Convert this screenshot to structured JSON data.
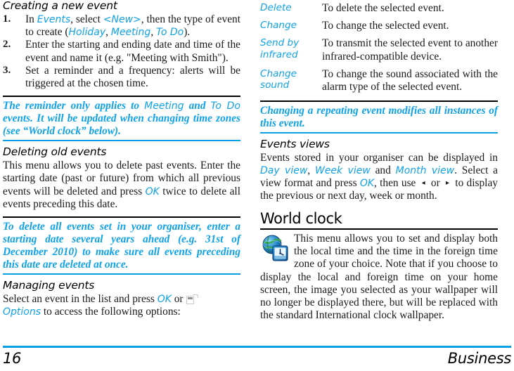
{
  "meta": {
    "accent_blue": "#10a2e8",
    "rule_blue": "#0aa0e4",
    "rule_black": "#000000"
  },
  "left_column": {
    "section_creating": {
      "heading": "Creating a new event",
      "steps": [
        {
          "num": "1.",
          "parts": [
            {
              "t": "In ",
              "s": "plain"
            },
            {
              "t": "Events",
              "s": "kw"
            },
            {
              "t": ", select ",
              "s": "plain"
            },
            {
              "t": "<New>",
              "s": "kw"
            },
            {
              "t": ", then the type of event to create (",
              "s": "plain"
            },
            {
              "t": "Holiday",
              "s": "kw"
            },
            {
              "t": ", ",
              "s": "plain"
            },
            {
              "t": "Meeting",
              "s": "kw"
            },
            {
              "t": ", ",
              "s": "plain"
            },
            {
              "t": "To Do",
              "s": "kw"
            },
            {
              "t": ").",
              "s": "plain"
            }
          ],
          "plain_text": "In Events, select <New>, then the type of event to create (Holiday, Meeting, To Do)."
        },
        {
          "num": "2.",
          "parts": [
            {
              "t": "Enter the starting and ending date and time of the event and name it (e.g. \"Meeting with Smith\").",
              "s": "plain"
            }
          ],
          "plain_text": "Enter the starting and ending date and time of the event and name it (e.g. \"Meeting with Smith\")."
        },
        {
          "num": "3.",
          "parts": [
            {
              "t": "Set a reminder and a frequency: alerts will be triggered at the chosen time.",
              "s": "plain"
            }
          ],
          "plain_text": "Set a reminder and a frequency: alerts will be triggered at the chosen time."
        }
      ]
    },
    "note_reminder": {
      "parts": [
        {
          "t": "The reminder only applies to ",
          "s": "bold"
        },
        {
          "t": "Meeting",
          "s": "plain"
        },
        {
          "t": " and ",
          "s": "bold"
        },
        {
          "t": "To Do",
          "s": "plain"
        },
        {
          "t": " events. It will be updated when changing time zones (see “World clock” below).",
          "s": "bold"
        }
      ],
      "plain_text": "The reminder only applies to Meeting and To Do events. It will be updated when changing time zones (see “World clock” below)."
    },
    "section_deleting": {
      "heading": "Deleting old events",
      "parts": [
        {
          "t": "This menu allows you to delete past events. Enter the starting date (past or future) from which all previous events will be deleted and press ",
          "s": "plain"
        },
        {
          "t": "OK",
          "s": "kw"
        },
        {
          "t": " twice to delete all events preceding this date.",
          "s": "plain"
        }
      ],
      "plain_text": "This menu allows you to delete past events. Enter the starting date (past or future) from which all previous events will be deleted and press OK twice to delete all events preceding this date."
    },
    "note_delete_all": {
      "parts": [
        {
          "t": "To delete all events set in your organiser, enter a starting date several years ahead (e.g. 31st of December 2010) to make sure all events preceding this date are deleted at once.",
          "s": "bold"
        }
      ],
      "plain_text": "To delete all events set in your organiser, enter a starting date several years ahead (e.g. 31st of December 2010) to make sure all events preceding this date are deleted at once."
    },
    "section_managing": {
      "heading": "Managing events",
      "lead_1": "Select an event in the list and press ",
      "key_ok": "OK",
      "lead_2": " or ",
      "softkey_icon": "left-softkey-icon",
      "key_options": "Options",
      "lead_3": " to access the following options:",
      "plain_text": "Select an event in the list and press OK or [softkey] Options to access the following options:"
    }
  },
  "right_column": {
    "options_table": {
      "rows": [
        {
          "key": "Delete",
          "value": "To delete the selected event."
        },
        {
          "key": "Change",
          "value": "To change the selected event."
        },
        {
          "key": "Send by infrared",
          "value": "To transmit the selected event to another infrared-compatible device."
        },
        {
          "key": "Change sound",
          "value": "To change the sound associated with the alarm type of the selected event."
        }
      ]
    },
    "note_repeating": {
      "plain_text": "Changing a repeating event modifies all instances of this event."
    },
    "section_events_views": {
      "heading": "Events views",
      "parts": [
        {
          "t": "Events stored in your organiser can be displayed in ",
          "s": "plain"
        },
        {
          "t": "Day view",
          "s": "kw"
        },
        {
          "t": ", ",
          "s": "plain"
        },
        {
          "t": "Week view",
          "s": "kw"
        },
        {
          "t": " and ",
          "s": "plain"
        },
        {
          "t": "Month view",
          "s": "kw"
        },
        {
          "t": ". Select a view format and press ",
          "s": "plain"
        },
        {
          "t": "OK",
          "s": "kw"
        },
        {
          "t": ", then use ",
          "s": "plain"
        },
        {
          "t": "◂",
          "s": "arrow"
        },
        {
          "t": " or ",
          "s": "plain"
        },
        {
          "t": "▸",
          "s": "arrow"
        },
        {
          "t": " to display the previous or next day, week or month.",
          "s": "plain"
        }
      ],
      "plain_text": "Events stored in your organiser can be displayed in Day view, Week view and Month view. Select a view format and press OK, then use ◂ or ▸ to display the previous or next day, week or month.",
      "arrow_left": "◂",
      "arrow_right": "▸"
    },
    "section_world_clock": {
      "heading": "World clock",
      "icon": "globe-clock-icon",
      "body": "This menu allows you to set and display both the local time and the time in the foreign time zone of your choice. Note that if you choose to display the local and foreign time on your home screen, the image you selected as your wallpaper will no longer be displayed there, but will be replaced with the standard International clock wallpaper."
    }
  },
  "footer": {
    "page_number": "16",
    "chapter": "Business"
  }
}
